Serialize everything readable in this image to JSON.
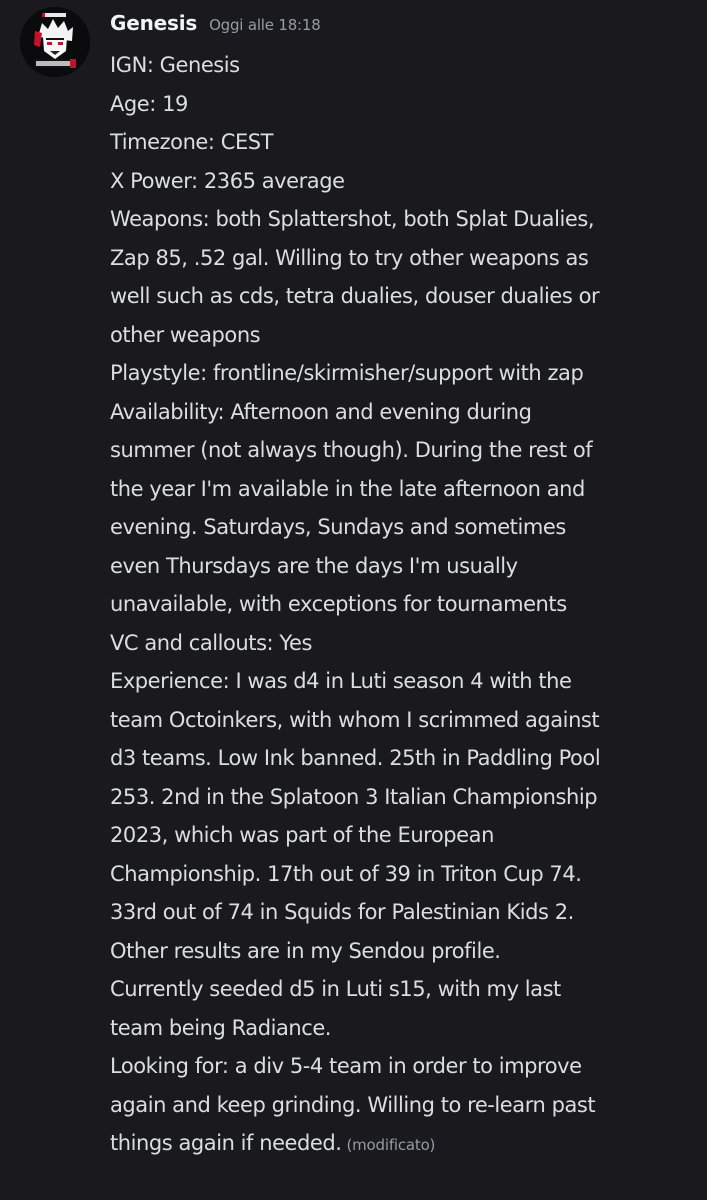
{
  "message": {
    "author": "Genesis",
    "timestamp": "Oggi alle 18:18",
    "avatar_icon": "anime-character-avatar-icon",
    "edited_label": "(modificato)",
    "lines": [
      "IGN: Genesis",
      "Age: 19",
      "Timezone: CEST",
      "X Power: 2365 average",
      "Weapons: both Splattershot, both Splat Dualies,",
      "Zap 85, .52 gal. Willing to try other weapons as",
      "well such as cds, tetra dualies, douser dualies or",
      "other weapons",
      "Playstyle: frontline/skirmisher/support with zap",
      "Availability: Afternoon and evening during",
      "summer (not always though). During the rest of",
      "the year I'm available in the late afternoon and",
      "evening. Saturdays, Sundays and sometimes",
      "even Thursdays are the days I'm usually",
      "unavailable, with exceptions for tournaments",
      "VC and callouts: Yes",
      "Experience: I was d4 in Luti season 4 with the",
      "team Octoinkers, with whom I scrimmed against",
      "d3 teams. Low Ink banned. 25th in Paddling Pool",
      "253. 2nd in the Splatoon 3 Italian Championship",
      "2023, which was part of the European",
      "Championship. 17th out of 39 in Triton Cup 74.",
      "33rd out of 74 in Squids for Palestinian Kids 2.",
      "Other results are in my Sendou profile.",
      "Currently seeded d5 in Luti s15, with my last",
      "team being Radiance.",
      "Looking for: a div 5-4 team in order to improve",
      "again and keep grinding. Willing to re-learn past",
      "things again if needed."
    ]
  }
}
